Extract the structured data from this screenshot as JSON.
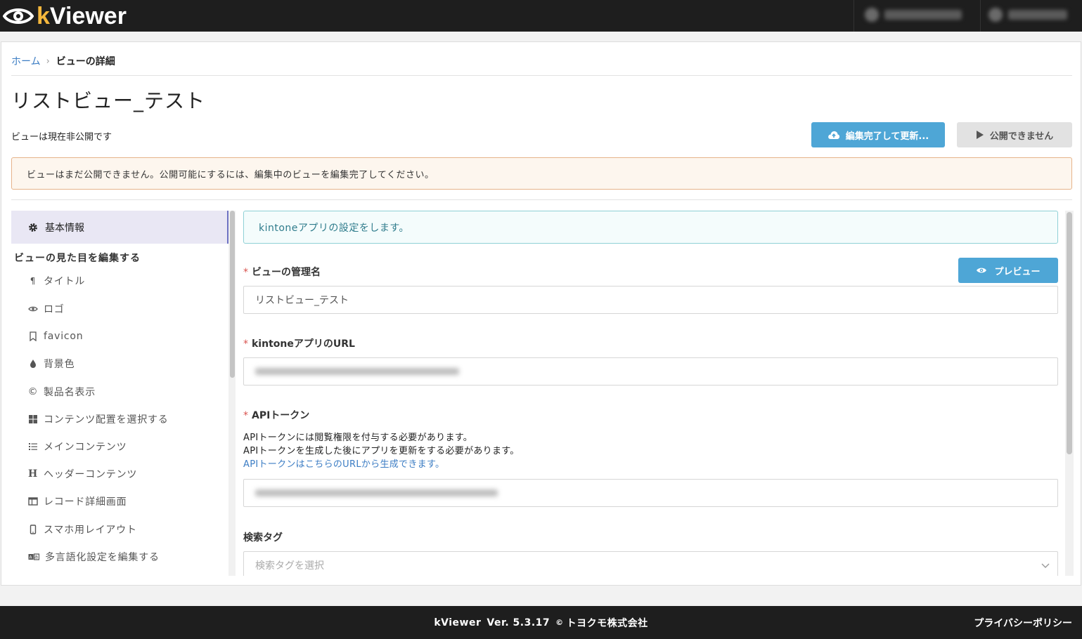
{
  "header": {
    "logo_prefix": "k",
    "logo_rest": "Viewer"
  },
  "breadcrumb": {
    "home": "ホーム",
    "separator": "›",
    "current": "ビューの詳細"
  },
  "page": {
    "title": "リストビュー_テスト",
    "status": "ビューは現在非公開です",
    "primary_button": "編集完了して更新...",
    "disabled_button": "公開できません",
    "warning": "ビューはまだ公開できません。公開可能にするには、編集中のビューを編集完了してください。"
  },
  "sidebar": {
    "active": {
      "icon": "gear-icon",
      "label": "基本情報"
    },
    "section_title": "ビューの見た目を編集する",
    "items": [
      {
        "icon": "paragraph-icon",
        "label": "タイトル"
      },
      {
        "icon": "eye-icon",
        "label": "ロゴ"
      },
      {
        "icon": "bookmark-icon",
        "label": "favicon"
      },
      {
        "icon": "droplet-icon",
        "label": "背景色"
      },
      {
        "icon": "copyright-icon",
        "label": "製品名表示"
      },
      {
        "icon": "grid-icon",
        "label": "コンテンツ配置を選択する"
      },
      {
        "icon": "list-icon",
        "label": "メインコンテンツ"
      },
      {
        "icon": "header-icon",
        "label": "ヘッダーコンテンツ"
      },
      {
        "icon": "table-icon",
        "label": "レコード詳細画面"
      },
      {
        "icon": "mobile-icon",
        "label": "スマホ用レイアウト"
      },
      {
        "icon": "language-icon",
        "label": "多言語化設定を編集する"
      }
    ]
  },
  "form": {
    "info": "kintoneアプリの設定をします。",
    "required_mark": "*",
    "preview_button": "プレビュー",
    "name_label": "ビューの管理名",
    "name_value": "リストビュー_テスト",
    "url_label": "kintoneアプリのURL",
    "token_label": "APIトークン",
    "token_help_1": "APIトークンには閲覧権限を付与する必要があります。",
    "token_help_2": "APIトークンを生成した後にアプリを更新をする必要があります。",
    "token_help_link": "APIトークンはこちらのURLから生成できます。",
    "tag_label": "検索タグ",
    "tag_placeholder": "検索タグを選択"
  },
  "footer": {
    "product": "kViewer",
    "version": "Ver. 5.3.17",
    "copyright_symbol": "©",
    "company": "トヨクモ株式会社",
    "privacy": "プライバシーポリシー"
  },
  "colors": {
    "accent": "#4ea6d6",
    "logo_k": "#f4b73c",
    "topbar": "#1e1e1e",
    "required": "#d9534f"
  }
}
